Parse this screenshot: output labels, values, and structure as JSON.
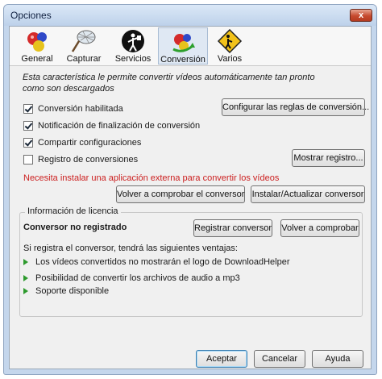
{
  "window": {
    "title": "Opciones",
    "close_label": "x"
  },
  "tabs": [
    {
      "label": "General",
      "icon": "general-balls-icon"
    },
    {
      "label": "Capturar",
      "icon": "net-icon"
    },
    {
      "label": "Servicios",
      "icon": "services-icon"
    },
    {
      "label": "Conversión",
      "icon": "conversion-icon",
      "selected": true
    },
    {
      "label": "Varios",
      "icon": "misc-sign-icon"
    }
  ],
  "description": "Esta característica le permite convertir vídeos automáticamente tan pronto como son descargados",
  "options": {
    "conversion_enabled": {
      "label": "Conversión habilitada",
      "checked": true
    },
    "notify": {
      "label": "Notificación de finalización de conversión",
      "checked": true
    },
    "share": {
      "label": "Compartir configuraciones",
      "checked": true
    },
    "log": {
      "label": "Registro de conversiones",
      "checked": false
    }
  },
  "buttons": {
    "configure_rules": "Configurar las reglas de conversión...",
    "show_log": "Mostrar registro...",
    "recheck": "Volver a comprobar el conversor",
    "install": "Instalar/Actualizar conversor",
    "register": "Registrar conversor",
    "check_again": "Volver a comprobar",
    "accept": "Aceptar",
    "cancel": "Cancelar",
    "help": "Ayuda"
  },
  "warning": "Necesita instalar una aplicación externa para convertir los vídeos",
  "warning_color": "#cc2020",
  "license": {
    "title": "Información de licencia",
    "status": "Conversor no registrado",
    "intro": "Si registra el conversor, tendrá las siguientes ventajas:",
    "benefits": [
      "Los vídeos convertidos no mostrarán el logo de DownloadHelper",
      "Posibilidad de convertir los archivos de audio a mp3",
      "Soporte disponible"
    ]
  }
}
